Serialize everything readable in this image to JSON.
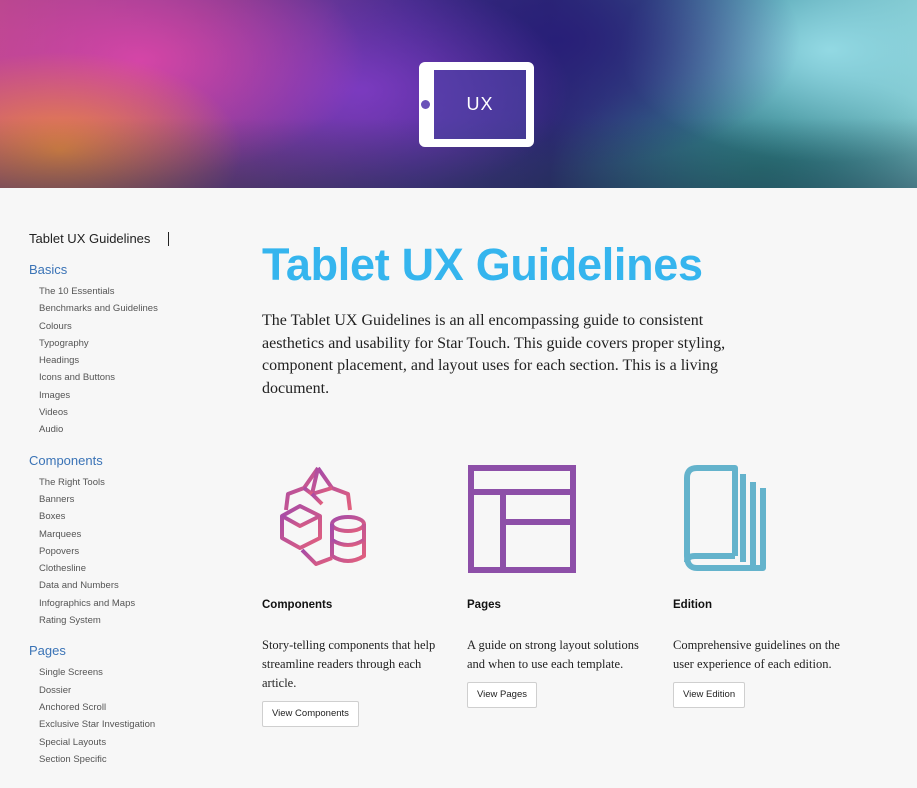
{
  "hero": {
    "logo_text": "UX"
  },
  "sidebar": {
    "title": "Tablet UX Guidelines",
    "sections": [
      {
        "heading": "Basics",
        "items": [
          "The 10 Essentials",
          "Benchmarks and Guidelines",
          "Colours",
          "Typography",
          "Headings",
          "Icons and Buttons",
          "Images",
          "Videos",
          "Audio"
        ]
      },
      {
        "heading": "Components",
        "items": [
          "The Right Tools",
          "Banners",
          "Boxes",
          "Marquees",
          "Popovers",
          "Clothesline",
          "Data and Numbers",
          "Infographics and Maps",
          "Rating System"
        ]
      },
      {
        "heading": "Pages",
        "items": [
          "Single Screens",
          "Dossier",
          "Anchored Scroll",
          "Exclusive Star Investigation",
          "Special Layouts",
          "Section Specific"
        ]
      }
    ]
  },
  "main": {
    "title": "Tablet UX Guidelines",
    "intro": "The Tablet UX Guidelines is an all encompassing guide to consistent aesthetics and usability for Star Touch. This guide covers proper styling, component placement, and layout uses for each section. This is a living document.",
    "cards": [
      {
        "icon": "components-shapes-icon",
        "title": "Components",
        "description": "Story-telling components that help streamline readers through each article.",
        "button": "View Components"
      },
      {
        "icon": "pages-layout-icon",
        "title": "Pages",
        "description": "A guide on strong layout solutions and when to use each template.",
        "button": "View Pages"
      },
      {
        "icon": "edition-book-icon",
        "title": "Edition",
        "description": "Comprehensive guidelines on the user experience of each edition.",
        "button": "View Edition"
      }
    ]
  },
  "colors": {
    "title_blue": "#35b5ee",
    "section_link_blue": "#3a73b6",
    "components_icon_gradient": [
      "#a54aa8",
      "#e2607d"
    ],
    "pages_icon": "#8d4fa8",
    "edition_icon": "#64b3cc"
  }
}
